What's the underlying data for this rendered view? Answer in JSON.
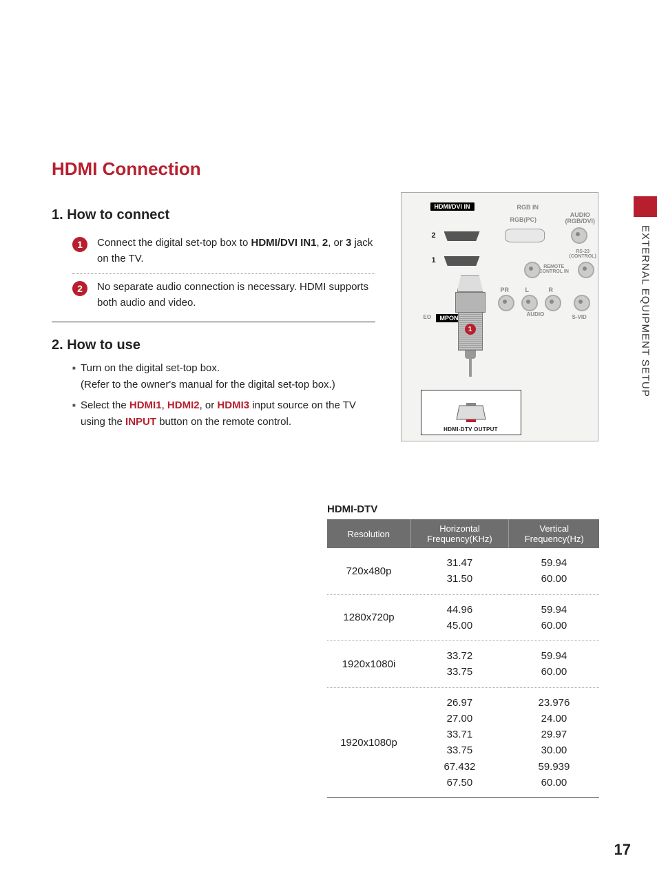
{
  "side_tab": "EXTERNAL EQUIPMENT SETUP",
  "page_number": "17",
  "title": "HDMI Connection",
  "section1": {
    "heading": "1. How to connect",
    "step1_pre": "Connect the digital set-top box to ",
    "step1_jack": "HDMI/DVI IN1",
    "step1_mid": ", ",
    "step1_jack2": "2",
    "step1_mid2": ", or ",
    "step1_jack3": "3",
    "step1_post": " jack on the TV.",
    "step2": "No separate audio connection is necessary. HDMI supports both audio and video."
  },
  "section2": {
    "heading": "2. How to use",
    "item1_line1": "Turn on the digital set-top box.",
    "item1_line2": "(Refer to the owner's manual for the digital set-top box.)",
    "item2_pre": "Select the ",
    "item2_h1": "HDMI1",
    "item2_c1": ", ",
    "item2_h2": "HDMI2",
    "item2_c2": ", or ",
    "item2_h3": "HDMI3",
    "item2_mid": " input source on the TV using the ",
    "item2_input": "INPUT",
    "item2_post": " button on the remote control."
  },
  "diagram": {
    "hdmi_dvi_in": "HDMI/DVI IN",
    "rgb_in": "RGB IN",
    "rgb_pc": "RGB(PC)",
    "audio_rgbdvi_l1": "AUDIO",
    "audio_rgbdvi_l2": "(RGB/DVI)",
    "rs232_l1": "RS-23",
    "rs232_l2": "(CONTROL)",
    "remote_l1": "REMOTE",
    "remote_l2": "CONTROL IN",
    "pr": "PR",
    "l": "L",
    "r": "R",
    "audio": "AUDIO",
    "mponent_in": "MPONENT IN",
    "svid": "S-VID",
    "eo": "EO",
    "port1": "1",
    "port2": "2",
    "callout1": "1",
    "source_label": "HDMI-DTV OUTPUT"
  },
  "table": {
    "title": "HDMI-DTV",
    "headers": {
      "res": "Resolution",
      "h_l1": "Horizontal",
      "h_l2": "Frequency(KHz)",
      "v_l1": "Vertical",
      "v_l2": "Frequency(Hz)"
    },
    "rows": [
      {
        "res": "720x480p",
        "h": "31.47\n31.50",
        "v": "59.94\n60.00"
      },
      {
        "res": "1280x720p",
        "h": "44.96\n45.00",
        "v": "59.94\n60.00"
      },
      {
        "res": "1920x1080i",
        "h": "33.72\n33.75",
        "v": "59.94\n60.00"
      },
      {
        "res": "1920x1080p",
        "h": "26.97\n27.00\n33.71\n33.75\n67.432\n67.50",
        "v": "23.976\n24.00\n29.97\n30.00\n59.939\n60.00"
      }
    ]
  }
}
